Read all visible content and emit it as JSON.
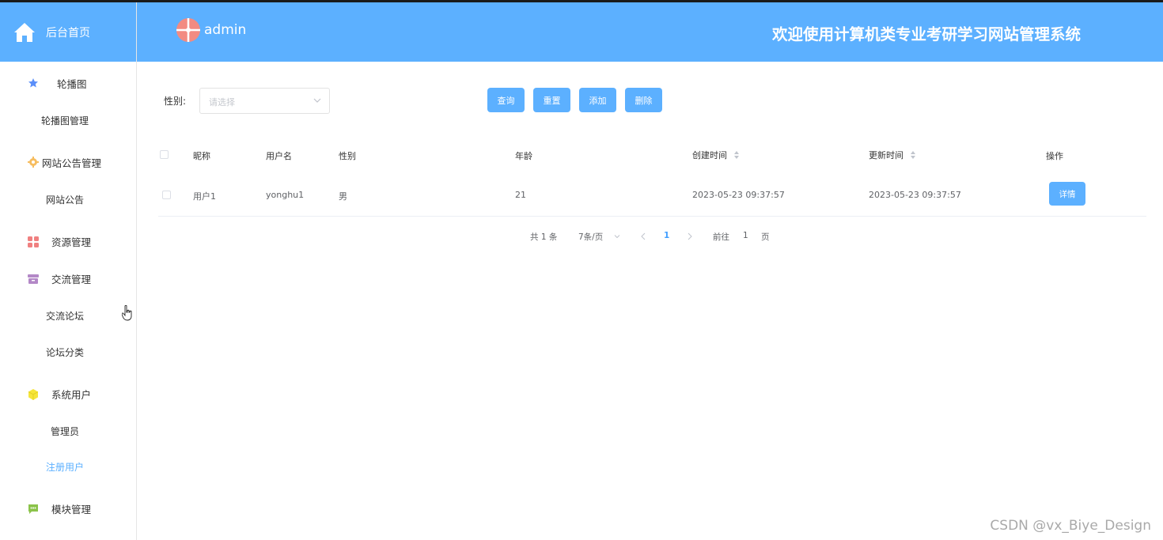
{
  "app": {
    "home_label": "后台首页",
    "username": "admin",
    "system_title": "欢迎使用计算机类专业考研学习网站管理系统",
    "accent_color": "#5cb0ff"
  },
  "sidebar": {
    "menus": [
      {
        "label": "轮播图",
        "icon": "star-icon",
        "color": "#5b8ff9"
      },
      {
        "label": "网站公告管理",
        "icon": "gear-icon",
        "color": "#f6bd60"
      },
      {
        "label": "资源管理",
        "icon": "grid-icon",
        "color": "#f08080"
      },
      {
        "label": "交流管理",
        "icon": "box-icon",
        "color": "#b388c7"
      },
      {
        "label": "系统用户",
        "icon": "cube-icon",
        "color": "#f5e53b"
      },
      {
        "label": "模块管理",
        "icon": "chat-icon",
        "color": "#8bc34a"
      }
    ],
    "subitems": [
      {
        "label": "轮播图管理"
      },
      {
        "label": "网站公告"
      },
      {
        "label": "交流论坛"
      },
      {
        "label": "论坛分类"
      },
      {
        "label": "管理员"
      },
      {
        "label": "注册用户"
      }
    ]
  },
  "filter": {
    "gender_label": "性别:",
    "gender_placeholder": "请选择"
  },
  "toolbar": {
    "query": "查询",
    "reset": "重置",
    "add": "添加",
    "delete": "删除"
  },
  "table": {
    "headers": [
      "昵称",
      "用户名",
      "性别",
      "年龄",
      "创建时间",
      "更新时间",
      "操作"
    ],
    "rows": [
      {
        "nickname": "用户1",
        "username": "yonghu1",
        "gender": "男",
        "age": "21",
        "created": "2023-05-23 09:37:57",
        "updated": "2023-05-23 09:37:57",
        "action": "详情"
      }
    ]
  },
  "pagination": {
    "total": "共 1 条",
    "page_size": "7条/页",
    "current_page": "1",
    "goto_prefix": "前往",
    "goto_value": "1",
    "goto_suffix": "页"
  },
  "watermark": "CSDN @vx_Biye_Design"
}
